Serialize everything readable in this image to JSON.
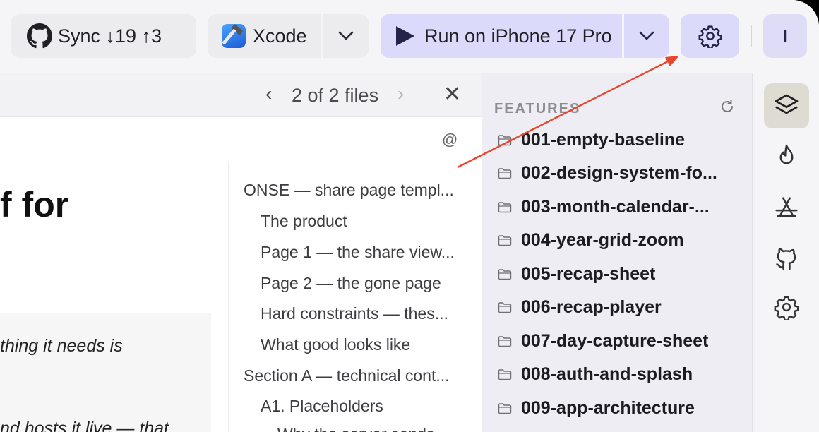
{
  "toolbar": {
    "sync_label": "Sync ↓19 ↑3",
    "xcode_label": "Xcode",
    "run_label": "Run on iPhone 17 Pro",
    "avatar_initial": "I"
  },
  "file_nav": {
    "prev": "‹",
    "count": "2 of 2 files",
    "next": "›",
    "close": "✕"
  },
  "document": {
    "at_symbol": "@",
    "heading_fragment": "f for",
    "callout_line_1": "thing it needs is",
    "callout_line_2": "nd hosts it live — that"
  },
  "outline": {
    "items": [
      "ONSE — share page templ...",
      "The product",
      "Page 1 — the share view...",
      "Page 2 — the gone page",
      "Hard constraints — thes...",
      "What good looks like",
      "Section A — technical cont...",
      "A1. Placeholders",
      "Why the server sends"
    ]
  },
  "features": {
    "title": "FEATURES",
    "items": [
      "001-empty-baseline",
      "002-design-system-fo...",
      "003-month-calendar-...",
      "004-year-grid-zoom",
      "005-recap-sheet",
      "006-recap-player",
      "007-day-capture-sheet",
      "008-auth-and-splash",
      "009-app-architecture"
    ]
  },
  "rail": {
    "icons": [
      "layers-icon",
      "flame-icon",
      "app-store-icon",
      "github-icon",
      "gear-icon"
    ]
  },
  "colors": {
    "accent": "#dcdafb",
    "arrow": "#e8472e"
  }
}
